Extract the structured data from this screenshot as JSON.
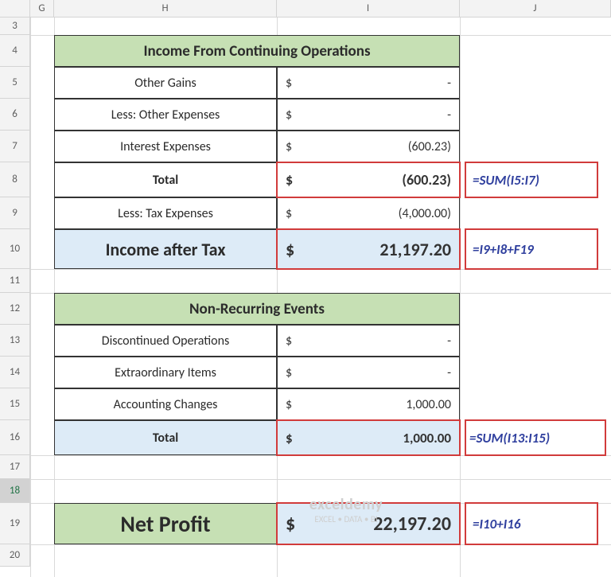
{
  "columns": [
    "G",
    "H",
    "I",
    "J"
  ],
  "rows": [
    "3",
    "4",
    "5",
    "6",
    "7",
    "8",
    "9",
    "10",
    "11",
    "12",
    "13",
    "14",
    "15",
    "16",
    "17",
    "18",
    "19",
    "20"
  ],
  "table1": {
    "header": "Income From Continuing Operations",
    "rows": [
      {
        "label": "Other Gains",
        "sym": "$",
        "val": "-"
      },
      {
        "label": "Less: Other Expenses",
        "sym": "$",
        "val": "-"
      },
      {
        "label": "Interest Expenses",
        "sym": "$",
        "val": "(600.23)"
      },
      {
        "label": "Total",
        "sym": "$",
        "val": "(600.23)",
        "bold": true
      },
      {
        "label": "Less: Tax Expenses",
        "sym": "$",
        "val": "(4,000.00)"
      }
    ],
    "summary": {
      "label": "Income after Tax",
      "sym": "$",
      "val": "21,197.20"
    }
  },
  "table2": {
    "header": "Non-Recurring Events",
    "rows": [
      {
        "label": "Discontinued Operations",
        "sym": "$",
        "val": "-"
      },
      {
        "label": "Extraordinary Items",
        "sym": "$",
        "val": "-"
      },
      {
        "label": "Accounting Changes",
        "sym": "$",
        "val": "1,000.00"
      },
      {
        "label": "Total",
        "sym": "$",
        "val": "1,000.00",
        "bold": true
      }
    ]
  },
  "netprofit": {
    "label": "Net Profit",
    "sym": "$",
    "val": "22,197.20"
  },
  "formulas": {
    "f8": "=SUM(I5:I7)",
    "f10": "=I9+I8+F19",
    "f16": "=SUM(I13:I15)",
    "f19": "=I10+I16"
  },
  "watermark": {
    "top": "exceldemy",
    "bottom": "EXCEL • DATA • BI"
  }
}
